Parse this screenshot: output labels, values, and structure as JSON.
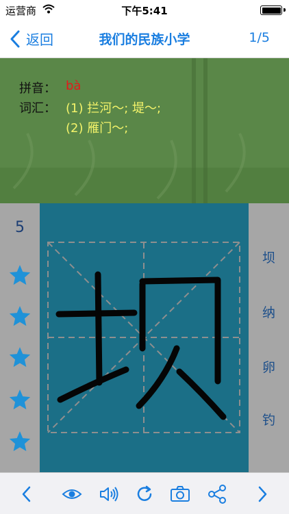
{
  "status_bar": {
    "carrier": "运营商",
    "time": "下午5:41"
  },
  "nav": {
    "back_label": "返回",
    "title": "我们的民族小学",
    "page_count": "1/5"
  },
  "info": {
    "pinyin_label": "拼音：",
    "pinyin_value": "bà",
    "vocab_label": "词汇：",
    "vocab_items": [
      "(1) 拦河～; 堤～;",
      "(2) 雁门～;"
    ]
  },
  "practice": {
    "stroke_count": "5",
    "star_count": 5,
    "character": "坝"
  },
  "related_chars": [
    "坝",
    "纳",
    "卵",
    "钓"
  ],
  "toolbar": [
    "chevron-left-icon",
    "eye-icon",
    "speaker-icon",
    "refresh-icon",
    "camera-icon",
    "share-icon",
    "chevron-right-icon"
  ],
  "colors": {
    "accent": "#1a7ee0",
    "canvas": "#1b6f87",
    "star": "#1f92d8",
    "pinyin": "#e2191b",
    "vocab": "#f3f36a"
  }
}
